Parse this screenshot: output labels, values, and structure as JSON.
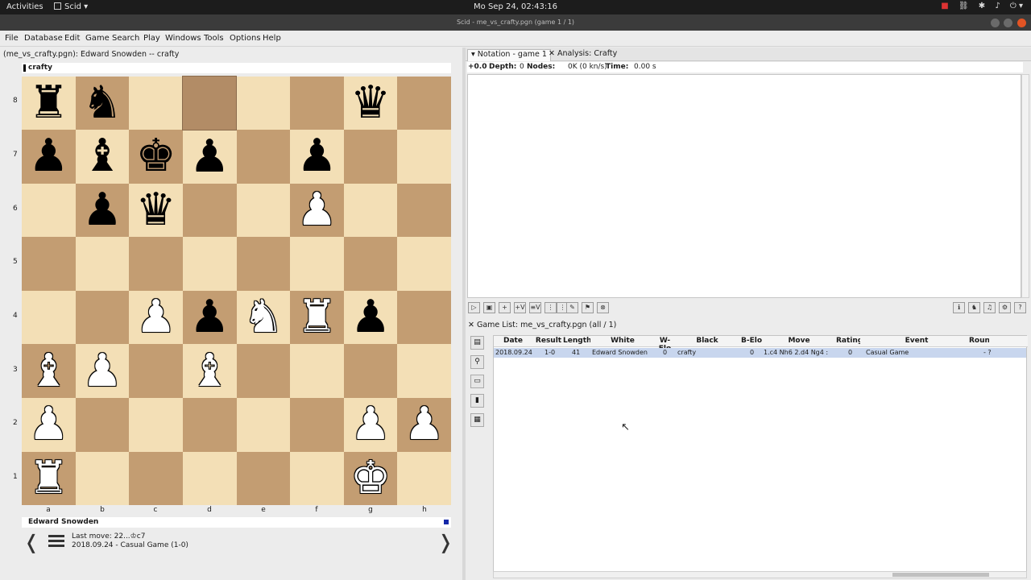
{
  "topbar": {
    "activities": "Activities",
    "app_menu": "Scid ▾",
    "clock": "Mo Sep 24, 02:43:16"
  },
  "window": {
    "title": "Scid - me_vs_crafty.pgn (game 1 / 1)"
  },
  "menu": [
    "File",
    "Database",
    "Edit",
    "Game",
    "Search",
    "Play",
    "Windows",
    "Tools",
    "Options",
    "Help"
  ],
  "board_pane": {
    "game_title": "(me_vs_crafty.pgn): Edward Snowden -- crafty",
    "top_player": "crafty",
    "bottom_player": "Edward Snowden",
    "last_move": "Last move: 22...♔c7",
    "game_info": "2018.09.24 - Casual Game (1-0)",
    "prev": "❬",
    "next": "❭",
    "ranks": [
      "8",
      "7",
      "6",
      "5",
      "4",
      "3",
      "2",
      "1"
    ],
    "files": [
      "a",
      "b",
      "c",
      "d",
      "e",
      "f",
      "g",
      "h"
    ],
    "position": [
      [
        "bR",
        "bN",
        "",
        "",
        "",
        "",
        "bQ",
        ""
      ],
      [
        "bP",
        "bB",
        "bK",
        "bP",
        "",
        "bP",
        "",
        ""
      ],
      [
        "",
        "bP",
        "bQ",
        "",
        "",
        "wP",
        "",
        ""
      ],
      [
        "",
        "",
        "",
        "",
        "",
        "",
        "",
        ""
      ],
      [
        "",
        "",
        "wP",
        "bP",
        "wN",
        "wR",
        "bP",
        ""
      ],
      [
        "wB",
        "wP",
        "",
        "wB",
        "",
        "",
        "",
        ""
      ],
      [
        "wP",
        "",
        "",
        "",
        "",
        "",
        "wP",
        "wP"
      ],
      [
        "wR",
        "",
        "",
        "",
        "",
        "",
        "wK",
        ""
      ]
    ]
  },
  "right_pane": {
    "tab_notation": "▾ Notation - game 1",
    "tab_analysis": "✕ Analysis: Crafty",
    "analysis": {
      "score": "+0.0",
      "depth_label": "Depth:",
      "depth": "0",
      "nodes_label": "Nodes:",
      "nodes": "0K (0 kn/s)",
      "time_label": "Time:",
      "time": "0.00 s"
    }
  },
  "game_list": {
    "title": "✕ Game List: me_vs_crafty.pgn (all / 1)",
    "columns": [
      "Date",
      "Result",
      "Length",
      "White",
      "W-Elo",
      "Black",
      "B-Elo",
      "Move",
      "Rating",
      "Event",
      "Round"
    ],
    "rows": [
      {
        "date": "2018.09.24",
        "result": "1-0",
        "length": "41",
        "white": "Edward Snowden",
        "welo": "0",
        "black": "crafty",
        "belo": "0",
        "move": "1.c4 Nh6  2.d4 Ng4 :",
        "rating": "0",
        "event": "Casual Game",
        "round": "- ?"
      }
    ]
  }
}
